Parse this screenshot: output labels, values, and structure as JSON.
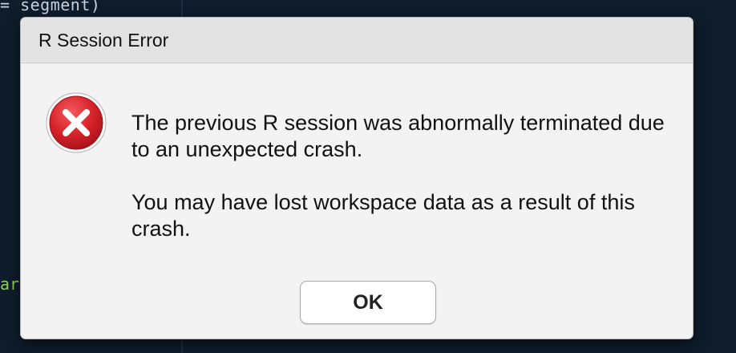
{
  "background_editor": {
    "code_top_line": "= segment)",
    "code_left_fragment": "ar'"
  },
  "dialog": {
    "title": "R Session Error",
    "icon": "error-x-icon",
    "message_paragraph_1": "The previous R session was abnormally terminated due to an unexpected crash.",
    "message_paragraph_2": "You may have lost workspace data as a result of this crash.",
    "ok_label": "OK"
  },
  "colors": {
    "editor_background": "#0e1c2b",
    "dialog_background": "#f3f3f3",
    "titlebar_background": "#e3e3e3",
    "error_red": "#d8232a",
    "code_green": "#8ad05c"
  }
}
